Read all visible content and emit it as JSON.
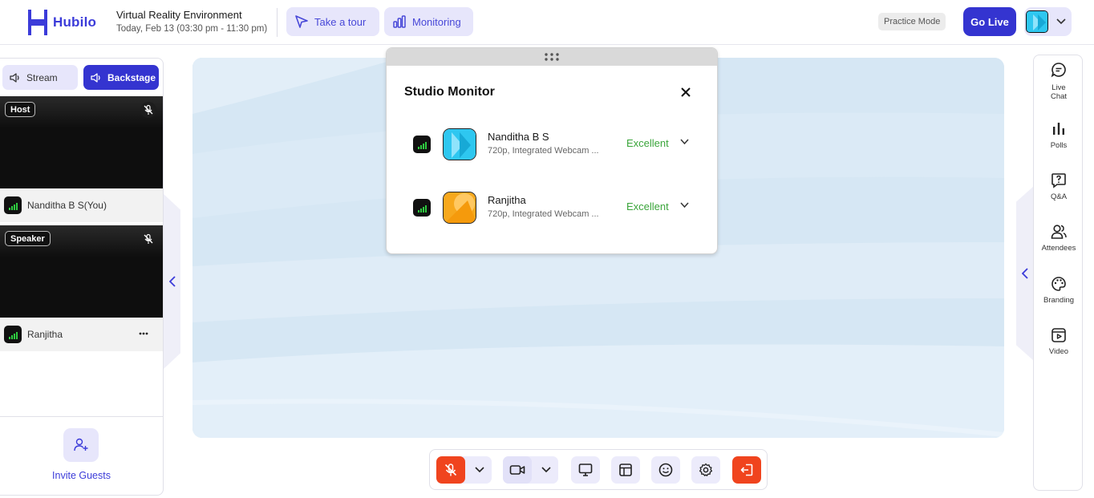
{
  "header": {
    "logo_text": "Hubilo",
    "event_title": "Virtual Reality Environment",
    "event_time": "Today, Feb 13 (03:30 pm - 11:30 pm)",
    "tour_label": "Take a tour",
    "monitoring_label": "Monitoring",
    "practice_mode_label": "Practice Mode",
    "go_live_label": "Go Live"
  },
  "left_panel": {
    "stream_label": "Stream",
    "backstage_label": "Backstage",
    "tiles": [
      {
        "role": "Host",
        "name": "Nanditha B S(You)"
      },
      {
        "role": "Speaker",
        "name": "Ranjitha"
      }
    ],
    "invite_label": "Invite Guests"
  },
  "monitor": {
    "title": "Studio Monitor",
    "rows": [
      {
        "name": "Nanditha B S",
        "device": "720p, Integrated Webcam ...",
        "quality": "Excellent"
      },
      {
        "name": "Ranjitha",
        "device": "720p, Integrated Webcam ...",
        "quality": "Excellent"
      }
    ]
  },
  "right_panel": {
    "items": [
      {
        "label": "Live Chat",
        "icon": "chat-icon"
      },
      {
        "label": "Polls",
        "icon": "polls-icon"
      },
      {
        "label": "Q&A",
        "icon": "qna-icon"
      },
      {
        "label": "Attendees",
        "icon": "attendees-icon"
      },
      {
        "label": "Branding",
        "icon": "palette-icon"
      },
      {
        "label": "Video",
        "icon": "video-icon"
      }
    ]
  },
  "colors": {
    "brand": "#3b3bd9",
    "accent_light": "#e7e6fb",
    "danger": "#f0441e",
    "quality_good": "#3aa53a"
  }
}
